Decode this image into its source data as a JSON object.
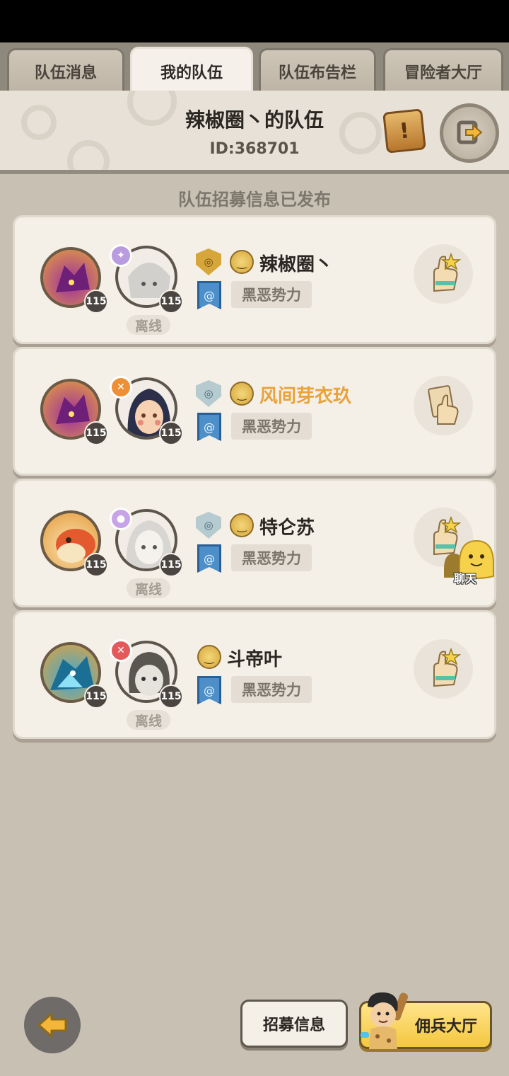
{
  "tabs": [
    {
      "label": "队伍消息",
      "active": false
    },
    {
      "label": "我的队伍",
      "active": true
    },
    {
      "label": "队伍布告栏",
      "active": false
    },
    {
      "label": "冒险者大厅",
      "active": false
    }
  ],
  "header": {
    "team_name": "辣椒圈丶的队伍",
    "team_id": "ID:368701",
    "notice_icon": "scroll-icon",
    "leave_icon": "exit-team-icon"
  },
  "publish_note": "队伍招募信息已发布",
  "members": [
    {
      "name": "辣椒圈丶",
      "name_color": "#2b2621",
      "pet_level": "115",
      "hero_level": "115",
      "offline": "离线",
      "faction": "黑恶势力",
      "rank_icon": "gold-rank-icon",
      "class_icon": "arcane-class-icon",
      "action_icon": "like-hand-icon"
    },
    {
      "name": "风间芽衣玖",
      "name_color": "#e8a33a",
      "pet_level": "115",
      "hero_level": "115",
      "offline": "",
      "faction": "黑恶势力",
      "rank_icon": "silver-rank-icon",
      "class_icon": "warrior-class-icon",
      "action_icon": "manage-card-icon"
    },
    {
      "name": "特仑苏",
      "name_color": "#2b2621",
      "pet_level": "115",
      "hero_level": "115",
      "offline": "离线",
      "faction": "黑恶势力",
      "rank_icon": "silver-rank-icon",
      "class_icon": "mage-class-icon",
      "action_icon": "like-hand-icon"
    },
    {
      "name": "斗帝叶",
      "name_color": "#2b2621",
      "pet_level": "115",
      "hero_level": "115",
      "offline": "离线",
      "faction": "黑恶势力",
      "rank_icon": "",
      "class_icon": "assassin-class-icon",
      "action_icon": "like-hand-icon"
    }
  ],
  "chat": {
    "label": "聊天"
  },
  "bottom": {
    "recruit_label": "招募信息",
    "merc_label": "佣兵大厅"
  }
}
